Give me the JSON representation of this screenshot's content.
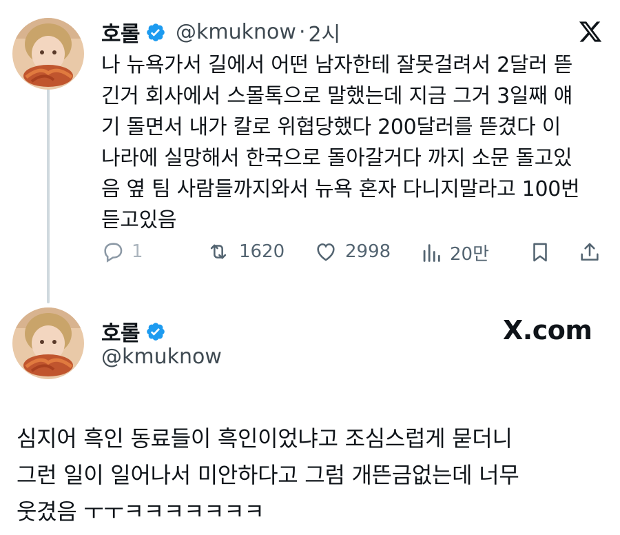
{
  "colors": {
    "verified": "#1d9bf0",
    "muted": "#536471",
    "text": "#0f1419",
    "thread_line": "#cfd9de"
  },
  "tweet1": {
    "display_name": "호롤",
    "handle": "@kmuknow",
    "separator": "·",
    "time": "2시",
    "logo": "x-logo-icon",
    "text": "나 뉴욕가서 길에서 어떤 남자한테 잘못걸려서 2달러 뜯\n긴거 회사에서 스몰톡으로 말했는데 지금 그거 3일째 얘\n기 돌면서 내가 칼로 위협당했다 200달러를 뜯겼다 이\n나라에 실망해서 한국으로 돌아갈거다 까지 소문 돌고있\n음 옆 팀 사람들까지와서 뉴욕 혼자 다니지말라고 100번\n듣고있음",
    "actions": {
      "reply": {
        "icon": "reply-icon",
        "count": "1"
      },
      "retweet": {
        "icon": "retweet-icon",
        "count": "1620"
      },
      "like": {
        "icon": "heart-icon",
        "count": "2998"
      },
      "views": {
        "icon": "views-icon",
        "count": "20만"
      },
      "bookmark": {
        "icon": "bookmark-icon"
      },
      "share": {
        "icon": "share-icon"
      }
    }
  },
  "tweet2": {
    "display_name": "호롤",
    "handle": "@kmuknow",
    "brand": "X.com",
    "text": "심지어 흑인 동료들이 흑인이었냐고 조심스럽게 묻더니\n그런 일이 일어나서 미안하다고 그럼 개뜬금없는데 너무\n웃겼음 ㅜㅜㅋㅋㅋㅋㅋㅋㅋ"
  }
}
